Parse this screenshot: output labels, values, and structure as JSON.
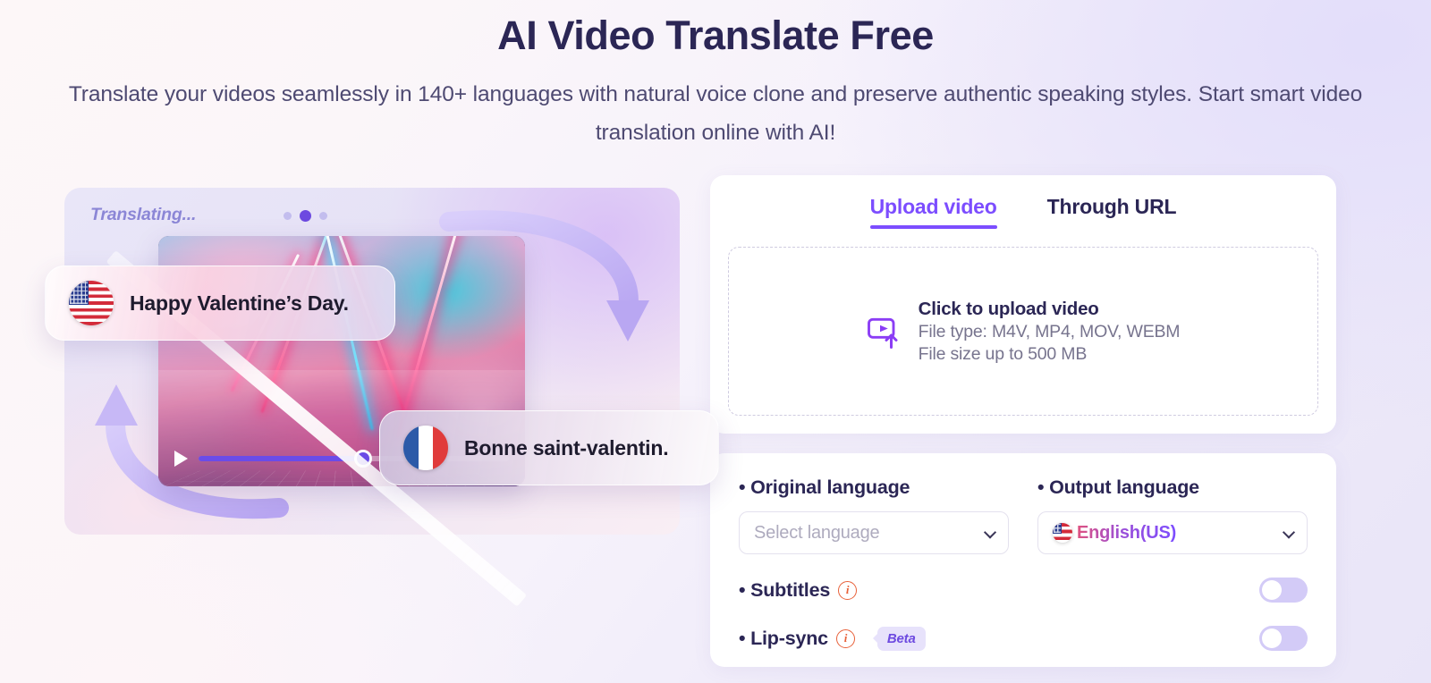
{
  "hero": {
    "title": "AI Video Translate Free",
    "subtitle": "Translate your videos seamlessly in 140+ languages with natural voice clone and preserve authentic speaking styles. Start smart video translation online with AI!"
  },
  "illustration": {
    "status_text": "Translating...",
    "source_caption": "Happy Valentine’s Day.",
    "target_caption": "Bonne saint-valentin.",
    "source_flag": "flag-us-icon",
    "target_flag": "flag-fr-icon",
    "play_icon": "play-icon",
    "progress_percent": 53
  },
  "upload_card": {
    "tabs": [
      {
        "label": "Upload video",
        "active": true
      },
      {
        "label": "Through URL",
        "active": false
      }
    ],
    "dropzone": {
      "icon": "video-upload-icon",
      "title": "Click to upload video",
      "file_types": "File type: M4V, MP4, MOV, WEBM",
      "file_size": "File size up to 500 MB"
    }
  },
  "options_card": {
    "original_language": {
      "label": "• Original language",
      "placeholder": "Select language",
      "value": ""
    },
    "output_language": {
      "label": "• Output language",
      "value": "English(US)",
      "flag": "flag-us-icon"
    },
    "subtitles": {
      "label": "• Subtitles",
      "info_icon": "info-icon",
      "enabled": false
    },
    "lip_sync": {
      "label": "• Lip-sync",
      "info_icon": "info-icon",
      "badge": "Beta",
      "enabled": false
    }
  },
  "colors": {
    "accent_purple": "#7c4dff",
    "title_navy": "#2b2655",
    "info_orange": "#e8613a",
    "toggle_track": "#d3cbf7",
    "beta_bg": "#e7e2fb"
  }
}
